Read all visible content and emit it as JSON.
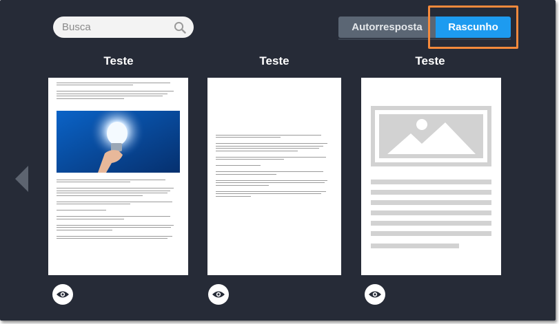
{
  "search": {
    "placeholder": "Busca"
  },
  "toggle": {
    "option_a": "Autorresposta",
    "option_b": "Rascunho",
    "selected": "Rascunho"
  },
  "colors": {
    "background": "#262b37",
    "accent": "#1d9bf0",
    "highlight": "#f58a3c",
    "inactive": "#5b6674"
  },
  "templates": [
    {
      "title": "Teste",
      "preview": "text-with-image",
      "preview_icon": "eye-icon"
    },
    {
      "title": "Teste",
      "preview": "text-only",
      "preview_icon": "eye-icon"
    },
    {
      "title": "Teste",
      "preview": "placeholder",
      "preview_icon": "eye-icon"
    }
  ],
  "nav": {
    "prev_icon": "chevron-left-icon"
  }
}
